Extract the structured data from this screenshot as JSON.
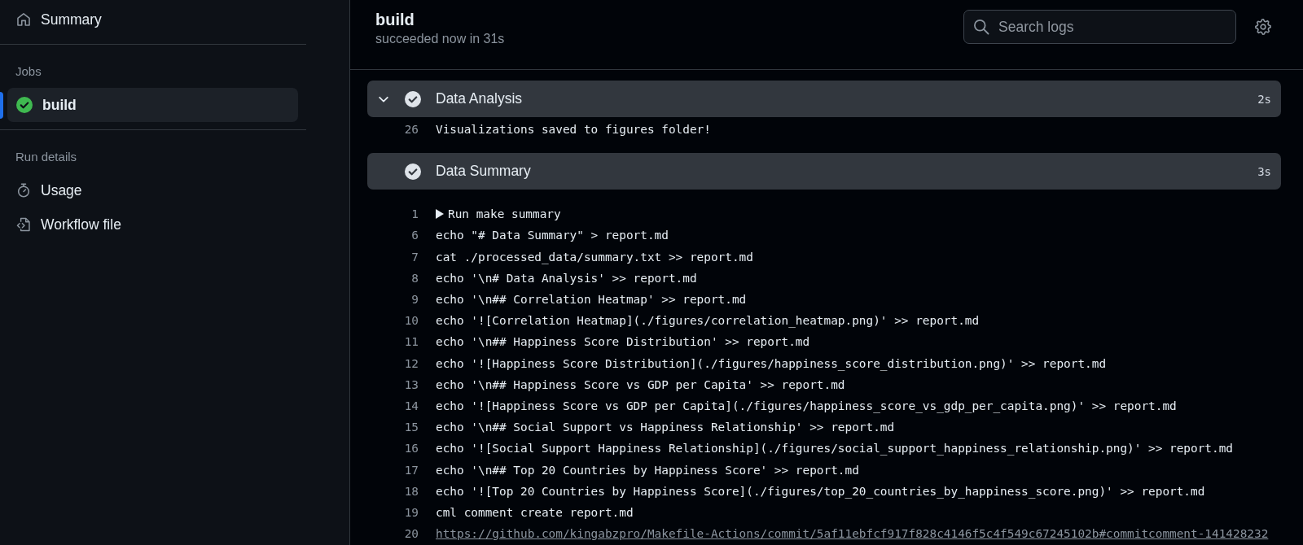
{
  "sidebar": {
    "sections": [
      {
        "items": [
          {
            "kind": "summary",
            "label": "Summary",
            "selected": false
          }
        ]
      },
      {
        "title": "Jobs",
        "items": [
          {
            "kind": "job",
            "label": "build",
            "succeeded": true,
            "selected": true
          }
        ]
      },
      {
        "title": "Run details",
        "items": [
          {
            "kind": "usage",
            "label": "Usage",
            "selected": false
          },
          {
            "kind": "workflow_file",
            "label": "Workflow file",
            "selected": false
          }
        ]
      }
    ]
  },
  "header": {
    "title": "build",
    "subtitle": "succeeded now in 31s",
    "search": {
      "placeholder": "Search logs"
    }
  },
  "steps": [
    {
      "title": "Data Analysis",
      "succeeded": true,
      "duration": "2s",
      "chevron_visible": true,
      "lines": [
        {
          "number": "26",
          "kind": "plain",
          "text": "Visualizations saved to figures folder!"
        }
      ]
    },
    {
      "title": "Data Summary",
      "succeeded": true,
      "duration": "3s",
      "chevron_visible": false,
      "lines": [
        {
          "number": "1",
          "kind": "group",
          "expanded": false,
          "text": "Run make summary"
        },
        {
          "number": "6",
          "kind": "plain",
          "text": "echo \"# Data Summary\" > report.md"
        },
        {
          "number": "7",
          "kind": "plain",
          "text": "cat ./processed_data/summary.txt >> report.md"
        },
        {
          "number": "8",
          "kind": "plain",
          "text": "echo '\\n# Data Analysis' >> report.md"
        },
        {
          "number": "9",
          "kind": "plain",
          "text": "echo '\\n## Correlation Heatmap' >> report.md"
        },
        {
          "number": "10",
          "kind": "plain",
          "text": "echo '![Correlation Heatmap](./figures/correlation_heatmap.png)' >> report.md"
        },
        {
          "number": "11",
          "kind": "plain",
          "text": "echo '\\n## Happiness Score Distribution' >> report.md"
        },
        {
          "number": "12",
          "kind": "plain",
          "text": "echo '![Happiness Score Distribution](./figures/happiness_score_distribution.png)' >> report.md"
        },
        {
          "number": "13",
          "kind": "plain",
          "text": "echo '\\n## Happiness Score vs GDP per Capita' >> report.md"
        },
        {
          "number": "14",
          "kind": "plain",
          "text": "echo '![Happiness Score vs GDP per Capita](./figures/happiness_score_vs_gdp_per_capita.png)' >> report.md"
        },
        {
          "number": "15",
          "kind": "plain",
          "text": "echo '\\n## Social Support vs Happiness Relationship' >> report.md"
        },
        {
          "number": "16",
          "kind": "plain",
          "text": "echo '![Social Support Happiness Relationship](./figures/social_support_happiness_relationship.png)' >> report.md"
        },
        {
          "number": "17",
          "kind": "plain",
          "text": "echo '\\n## Top 20 Countries by Happiness Score' >> report.md"
        },
        {
          "number": "18",
          "kind": "plain",
          "text": "echo '![Top 20 Countries by Happiness Score](./figures/top_20_countries_by_happiness_score.png)' >> report.md"
        },
        {
          "number": "19",
          "kind": "plain",
          "text": "cml comment create report.md"
        },
        {
          "number": "20",
          "kind": "link",
          "text": "https://github.com/kingabzpro/Makefile-Actions/commit/5af11ebfcf917f828c4146f5c4f549c67245102b#commitcomment-141428232"
        }
      ]
    }
  ]
}
